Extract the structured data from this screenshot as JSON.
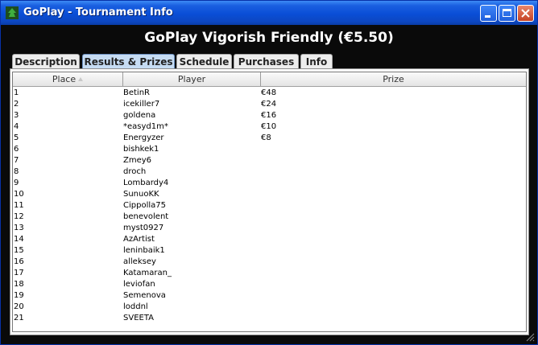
{
  "window": {
    "title": "GoPlay - Tournament Info"
  },
  "heading": "GoPlay Vigorish Friendly (€5.50)",
  "tabs": [
    {
      "label": "Description",
      "active": false
    },
    {
      "label": "Results & Prizes",
      "active": true
    },
    {
      "label": "Schedule",
      "active": false
    },
    {
      "label": "Purchases",
      "active": false
    },
    {
      "label": "Info",
      "active": false
    }
  ],
  "table": {
    "headers": {
      "place": "Place",
      "player": "Player",
      "prize": "Prize"
    },
    "sort_icon": "sort-ascending-icon",
    "rows": [
      {
        "place": "1",
        "player": "BetinR",
        "prize": "€48"
      },
      {
        "place": "2",
        "player": "icekiller7",
        "prize": "€24"
      },
      {
        "place": "3",
        "player": "goldena",
        "prize": "€16"
      },
      {
        "place": "4",
        "player": "*easyd1m*",
        "prize": "€10"
      },
      {
        "place": "5",
        "player": "Energyzer",
        "prize": "€8"
      },
      {
        "place": "6",
        "player": "bishkek1",
        "prize": ""
      },
      {
        "place": "7",
        "player": "Zmey6",
        "prize": ""
      },
      {
        "place": "8",
        "player": "droch",
        "prize": ""
      },
      {
        "place": "9",
        "player": "Lombardy4",
        "prize": ""
      },
      {
        "place": "10",
        "player": "SunuoKK",
        "prize": ""
      },
      {
        "place": "11",
        "player": "Cippolla75",
        "prize": ""
      },
      {
        "place": "12",
        "player": "benevolent",
        "prize": ""
      },
      {
        "place": "13",
        "player": "myst0927",
        "prize": ""
      },
      {
        "place": "14",
        "player": "AzArtist",
        "prize": ""
      },
      {
        "place": "15",
        "player": "leninbaik1",
        "prize": ""
      },
      {
        "place": "16",
        "player": "alleksey",
        "prize": ""
      },
      {
        "place": "17",
        "player": "Katamaran_",
        "prize": ""
      },
      {
        "place": "18",
        "player": "leviofan",
        "prize": ""
      },
      {
        "place": "19",
        "player": "Semenova",
        "prize": ""
      },
      {
        "place": "20",
        "player": "loddnl",
        "prize": ""
      },
      {
        "place": "21",
        "player": "SVEETA",
        "prize": ""
      }
    ]
  }
}
